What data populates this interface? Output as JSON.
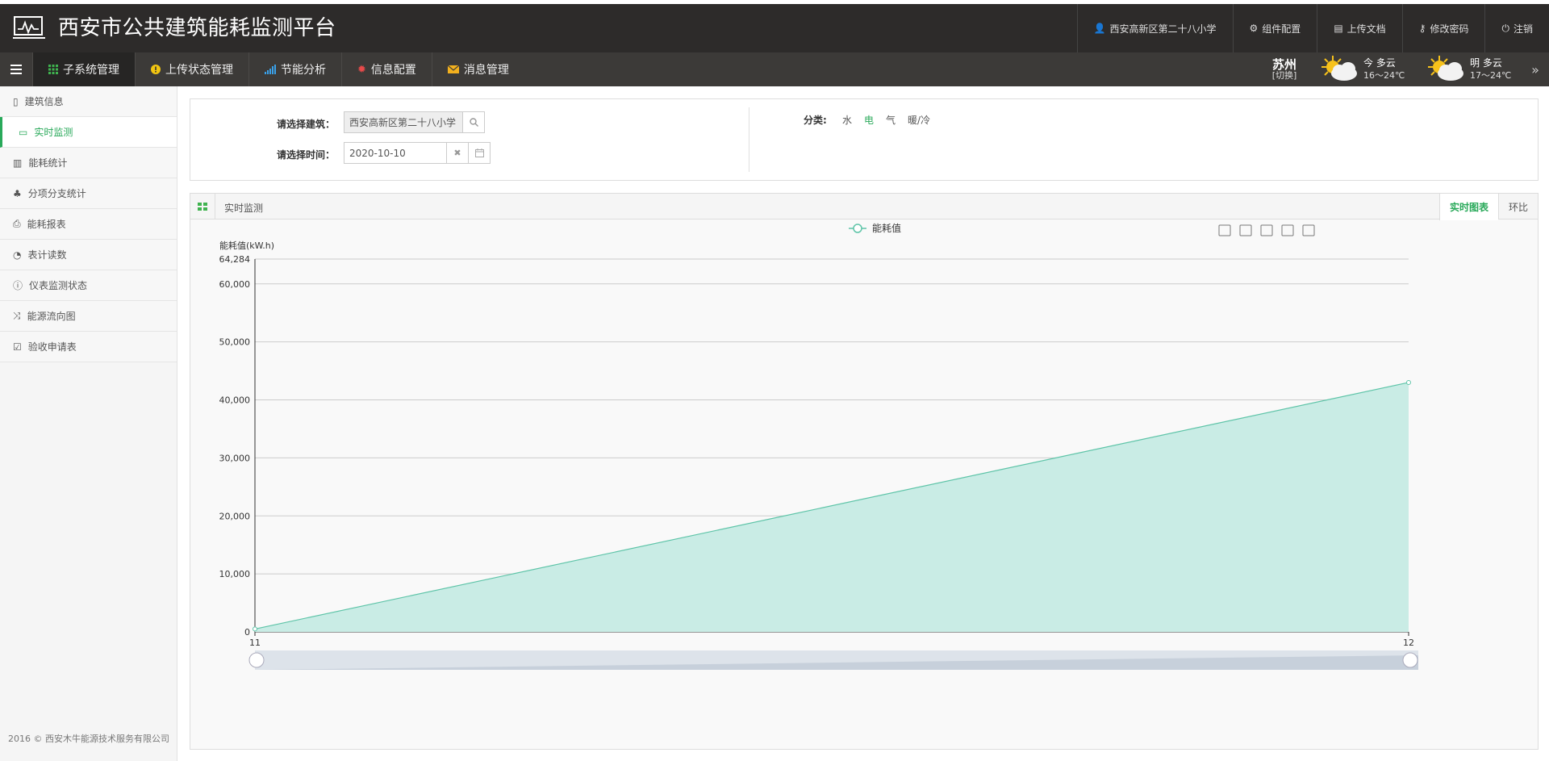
{
  "app": {
    "title": "西安市公共建筑能耗监测平台"
  },
  "topnav": [
    {
      "label": "西安高新区第二十八小学",
      "icon": "user-icon"
    },
    {
      "label": "组件配置",
      "icon": "gear-icon"
    },
    {
      "label": "上传文档",
      "icon": "book-icon"
    },
    {
      "label": "修改密码",
      "icon": "key-icon"
    },
    {
      "label": "注销",
      "icon": "power-icon"
    }
  ],
  "navbar": {
    "items": [
      {
        "label": "子系统管理",
        "icon": "grid-icon",
        "active": true
      },
      {
        "label": "上传状态管理",
        "icon": "alert-icon",
        "active": false
      },
      {
        "label": "节能分析",
        "icon": "signal-icon",
        "active": false
      },
      {
        "label": "信息配置",
        "icon": "cog-icon",
        "active": false
      },
      {
        "label": "消息管理",
        "icon": "envelope-icon",
        "active": false
      }
    ]
  },
  "weather": {
    "city": "苏州",
    "switch_label": "[切换]",
    "today": {
      "label": "今 多云",
      "temp": "16～24℃"
    },
    "tomorrow": {
      "label": "明 多云",
      "temp": "17～24℃"
    },
    "more": "»"
  },
  "sidebar": {
    "items": [
      {
        "label": "建筑信息",
        "icon": "building-icon",
        "active": false
      },
      {
        "label": "实时监测",
        "icon": "laptop-icon",
        "active": true
      },
      {
        "label": "能耗统计",
        "icon": "bar-chart-icon",
        "active": false
      },
      {
        "label": "分项分支统计",
        "icon": "sitemap-icon",
        "active": false
      },
      {
        "label": "能耗报表",
        "icon": "print-icon",
        "active": false
      },
      {
        "label": "表计读数",
        "icon": "dashboard-icon",
        "active": false
      },
      {
        "label": "仪表监测状态",
        "icon": "info-icon",
        "active": false
      },
      {
        "label": "能源流向图",
        "icon": "shuffle-icon",
        "active": false
      },
      {
        "label": "验收申请表",
        "icon": "checkbox-icon",
        "active": false
      }
    ],
    "footer": "2016 © 西安木牛能源技术服务有限公司"
  },
  "filter": {
    "building_label": "请选择建筑：",
    "building_value": "西安高新区第二十八小学",
    "time_label": "请选择时间：",
    "time_value": "2020-10-10",
    "category_label": "分类:",
    "categories": [
      {
        "label": "水",
        "active": false
      },
      {
        "label": "电",
        "active": true
      },
      {
        "label": "气",
        "active": false
      },
      {
        "label": "暖/冷",
        "active": false
      }
    ]
  },
  "panel": {
    "title": "实时监测",
    "tabs": [
      {
        "label": "实时图表",
        "active": true
      },
      {
        "label": "环比",
        "active": false
      }
    ]
  },
  "colors": {
    "accent": "#29a95a",
    "series_line": "#5ec4a8",
    "series_fill": "#c9ece5"
  },
  "chart_data": {
    "type": "area",
    "legend": [
      "能耗值"
    ],
    "ylabel": "能耗值(kW.h)",
    "x": [
      "11",
      "12"
    ],
    "series": [
      {
        "name": "能耗值",
        "values": [
          500,
          43000
        ]
      }
    ],
    "ylim": [
      0,
      64284
    ],
    "yticks": [
      0,
      10000,
      20000,
      30000,
      40000,
      50000,
      60000,
      64284
    ],
    "ytick_labels": [
      "0",
      "10,000",
      "20,000",
      "30,000",
      "40,000",
      "50,000",
      "60,000",
      "64,284"
    ],
    "grid": true,
    "toolbox": [
      "data-view-icon",
      "line-chart-icon",
      "bar-chart-icon",
      "restore-icon",
      "download-icon"
    ]
  }
}
